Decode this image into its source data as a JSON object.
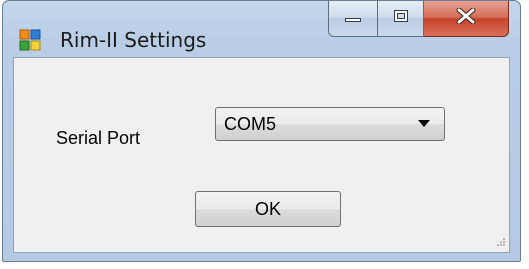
{
  "window": {
    "title": "Rim-II Settings"
  },
  "caption_buttons": {
    "minimize_icon": "minimize-icon",
    "maximize_icon": "maximize-icon",
    "close_icon": "close-icon"
  },
  "form": {
    "serial_port_label": "Serial Port",
    "serial_port_value": "COM5",
    "ok_label": "OK"
  },
  "colors": {
    "close_button": "#c7432a",
    "frame": "#b9cee6",
    "client_background": "#f0f0f0"
  }
}
